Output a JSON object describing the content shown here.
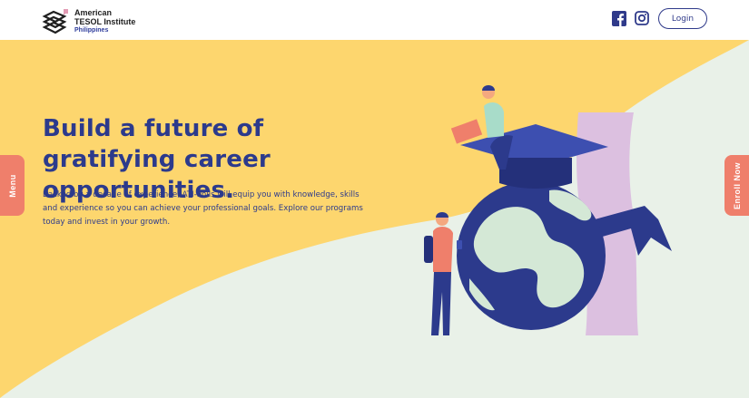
{
  "header": {
    "logo": {
      "line1": "American",
      "line2": "TESOL Institute",
      "line3": "Philippines"
    },
    "social": {
      "facebook_icon": "facebook-icon",
      "instagram_icon": "instagram-icon"
    },
    "login_label": "Login"
  },
  "hero": {
    "headline": "Build a future of gratifying career opportunities.",
    "description": "Backed by a decade of experience, ATI-Phils will equip you with knowledge, skills and experience so you can achieve your professional goals. Explore our programs today and invest in your growth."
  },
  "side_tabs": {
    "menu_label": "Menu",
    "enroll_label": "Enroll Now"
  },
  "colors": {
    "yellow": "#fdd66e",
    "mint": "#e9f1e8",
    "navy": "#2c3a8c",
    "coral": "#ef7f6b",
    "lilac": "#dcc0e0"
  }
}
